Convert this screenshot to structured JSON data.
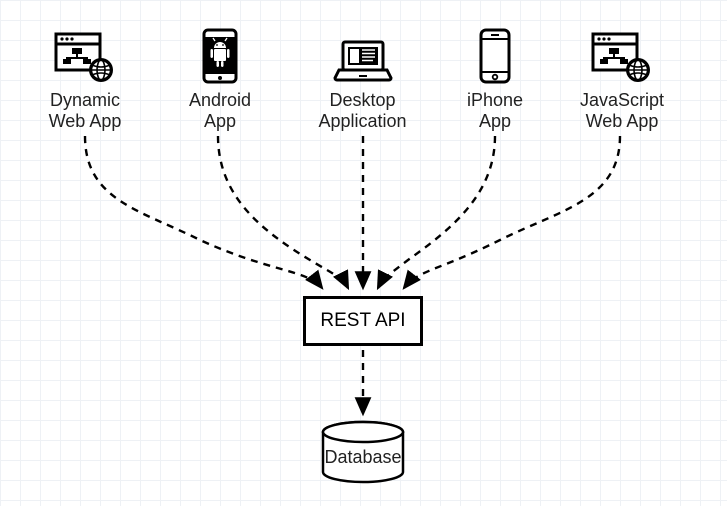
{
  "clients": [
    {
      "label_line1": "Dynamic",
      "label_line2": "Web App"
    },
    {
      "label_line1": "Android",
      "label_line2": "App"
    },
    {
      "label_line1": "Desktop",
      "label_line2": "Application"
    },
    {
      "label_line1": "iPhone",
      "label_line2": "App"
    },
    {
      "label_line1": "JavaScript",
      "label_line2": "Web App"
    }
  ],
  "rest": {
    "label": "REST API"
  },
  "database": {
    "label": "Database"
  }
}
